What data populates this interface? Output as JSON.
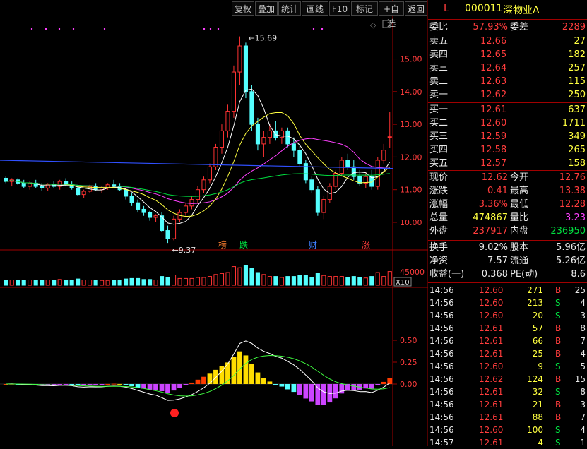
{
  "toolbar": {
    "buttons": [
      "复权",
      "叠加",
      "统计",
      "画线",
      "F10",
      "标记",
      "+自选",
      "返回"
    ]
  },
  "stock": {
    "flag": "L",
    "code": "000011",
    "name": "深物业A"
  },
  "order_ratio": {
    "label1": "委比",
    "value1": "57.93%",
    "label2": "委差",
    "value2": "2289"
  },
  "asks": [
    {
      "label": "卖五",
      "price": "12.66",
      "volume": "27"
    },
    {
      "label": "卖四",
      "price": "12.65",
      "volume": "182"
    },
    {
      "label": "卖三",
      "price": "12.64",
      "volume": "257"
    },
    {
      "label": "卖二",
      "price": "12.63",
      "volume": "115"
    },
    {
      "label": "卖一",
      "price": "12.62",
      "volume": "250"
    }
  ],
  "bids": [
    {
      "label": "买一",
      "price": "12.61",
      "volume": "637"
    },
    {
      "label": "买二",
      "price": "12.60",
      "volume": "1711"
    },
    {
      "label": "买三",
      "price": "12.59",
      "volume": "349"
    },
    {
      "label": "买四",
      "price": "12.58",
      "volume": "265"
    },
    {
      "label": "买五",
      "price": "12.57",
      "volume": "158"
    }
  ],
  "quote": [
    {
      "l1": "现价",
      "v1": "12.62",
      "c1": "red",
      "l2": "今开",
      "v2": "12.76",
      "c2": "red"
    },
    {
      "l1": "涨跌",
      "v1": "0.41",
      "c1": "red",
      "l2": "最高",
      "v2": "13.38",
      "c2": "red"
    },
    {
      "l1": "涨幅",
      "v1": "3.36%",
      "c1": "red",
      "l2": "最低",
      "v2": "12.28",
      "c2": "red"
    },
    {
      "l1": "总量",
      "v1": "474867",
      "c1": "yel",
      "l2": "量比",
      "v2": "3.23",
      "c2": "mag"
    },
    {
      "l1": "外盘",
      "v1": "237917",
      "c1": "red",
      "l2": "内盘",
      "v2": "236950",
      "c2": "green"
    }
  ],
  "fundamentals": [
    {
      "l1": "换手",
      "v1": "9.02%",
      "l2": "股本",
      "v2": "5.96亿"
    },
    {
      "l1": "净资",
      "v1": "7.57",
      "l2": "流通",
      "v2": "5.26亿"
    },
    {
      "l1": "收益(一)",
      "v1": "0.368",
      "l2": "PE(动)",
      "v2": "8.6"
    }
  ],
  "ticks": [
    {
      "time": "14:56",
      "price": "12.60",
      "vol": "271",
      "side": "B",
      "n": "25"
    },
    {
      "time": "14:56",
      "price": "12.60",
      "vol": "213",
      "side": "S",
      "n": "4"
    },
    {
      "time": "14:56",
      "price": "12.60",
      "vol": "20",
      "side": "S",
      "n": "3"
    },
    {
      "time": "14:56",
      "price": "12.61",
      "vol": "57",
      "side": "B",
      "n": "8"
    },
    {
      "time": "14:56",
      "price": "12.61",
      "vol": "66",
      "side": "B",
      "n": "7"
    },
    {
      "time": "14:56",
      "price": "12.61",
      "vol": "25",
      "side": "B",
      "n": "4"
    },
    {
      "time": "14:56",
      "price": "12.60",
      "vol": "9",
      "side": "S",
      "n": "5"
    },
    {
      "time": "14:56",
      "price": "12.62",
      "vol": "124",
      "side": "B",
      "n": "15"
    },
    {
      "time": "14:56",
      "price": "12.61",
      "vol": "32",
      "side": "S",
      "n": "8"
    },
    {
      "time": "14:56",
      "price": "12.61",
      "vol": "21",
      "side": "B",
      "n": "3"
    },
    {
      "time": "14:56",
      "price": "12.61",
      "vol": "88",
      "side": "B",
      "n": "7"
    },
    {
      "time": "14:56",
      "price": "12.60",
      "vol": "100",
      "side": "S",
      "n": "4"
    },
    {
      "time": "14:57",
      "price": "12.61",
      "vol": "4",
      "side": "S",
      "n": "1"
    }
  ],
  "chart_data": {
    "type": "candlestick",
    "price_axis": {
      "ticks": [
        "15.00",
        "14.00",
        "13.00",
        "12.00",
        "11.00",
        "10.00"
      ],
      "ylim": [
        9.2,
        16.2
      ]
    },
    "high_marker": "15.69",
    "low_marker": "9.37",
    "event_labels": [
      "榜",
      "跌",
      "财",
      "涨"
    ],
    "volume_axis": {
      "tick": "45000",
      "unit": "X10"
    },
    "macd_axis": {
      "ticks": [
        "0.50",
        "0.25",
        "0.00"
      ]
    },
    "candles": [
      [
        11.35,
        11.4,
        11.2,
        11.25
      ],
      [
        11.25,
        11.35,
        11.1,
        11.3
      ],
      [
        11.3,
        11.35,
        11.15,
        11.2
      ],
      [
        11.2,
        11.3,
        11.05,
        11.1
      ],
      [
        11.1,
        11.25,
        11.0,
        11.2
      ],
      [
        11.2,
        11.3,
        11.05,
        11.1
      ],
      [
        11.1,
        11.2,
        10.95,
        11.05
      ],
      [
        11.05,
        11.2,
        10.95,
        11.15
      ],
      [
        11.15,
        11.25,
        11.05,
        11.1
      ],
      [
        11.1,
        11.3,
        11.0,
        11.25
      ],
      [
        11.25,
        11.35,
        11.1,
        11.15
      ],
      [
        11.15,
        11.25,
        11.0,
        11.05
      ],
      [
        11.05,
        11.15,
        10.8,
        10.85
      ],
      [
        10.85,
        11.0,
        10.75,
        10.95
      ],
      [
        10.95,
        11.15,
        10.9,
        11.1
      ],
      [
        11.1,
        11.2,
        10.95,
        11.0
      ],
      [
        11.0,
        11.1,
        10.9,
        11.05
      ],
      [
        11.05,
        11.2,
        11.0,
        11.15
      ],
      [
        11.15,
        11.3,
        11.05,
        11.1
      ],
      [
        11.1,
        11.2,
        10.95,
        11.0
      ],
      [
        11.0,
        11.05,
        10.7,
        10.8
      ],
      [
        10.8,
        10.9,
        10.5,
        10.6
      ],
      [
        10.6,
        10.7,
        10.3,
        10.4
      ],
      [
        10.4,
        10.5,
        10.2,
        10.3
      ],
      [
        10.3,
        10.35,
        10.05,
        10.15
      ],
      [
        10.15,
        10.25,
        10.0,
        10.2
      ],
      [
        10.2,
        10.3,
        9.7,
        9.75
      ],
      [
        9.75,
        9.9,
        9.37,
        9.5
      ],
      [
        9.5,
        10.2,
        9.45,
        10.1
      ],
      [
        10.1,
        10.4,
        10.0,
        10.3
      ],
      [
        10.3,
        10.6,
        10.2,
        10.5
      ],
      [
        10.5,
        10.8,
        10.4,
        10.7
      ],
      [
        10.7,
        11.1,
        10.6,
        11.0
      ],
      [
        11.0,
        11.4,
        10.9,
        11.3
      ],
      [
        11.3,
        11.8,
        11.2,
        11.7
      ],
      [
        11.7,
        12.4,
        11.6,
        12.3
      ],
      [
        12.3,
        13.0,
        12.1,
        12.8
      ],
      [
        12.8,
        13.6,
        12.6,
        13.4
      ],
      [
        13.4,
        14.8,
        13.2,
        14.6
      ],
      [
        14.6,
        15.69,
        14.2,
        15.4
      ],
      [
        15.4,
        15.5,
        13.8,
        14.0
      ],
      [
        14.0,
        14.2,
        12.8,
        13.0
      ],
      [
        13.0,
        13.2,
        12.2,
        12.4
      ],
      [
        12.4,
        12.8,
        12.0,
        12.6
      ],
      [
        12.6,
        13.0,
        12.4,
        12.8
      ],
      [
        12.8,
        13.1,
        12.5,
        12.6
      ],
      [
        12.6,
        12.9,
        12.4,
        12.8
      ],
      [
        12.8,
        12.9,
        12.3,
        12.4
      ],
      [
        12.4,
        12.6,
        12.0,
        12.2
      ],
      [
        12.2,
        12.4,
        11.7,
        11.8
      ],
      [
        11.8,
        11.9,
        11.2,
        11.3
      ],
      [
        11.3,
        11.4,
        10.9,
        11.0
      ],
      [
        11.0,
        11.1,
        10.2,
        10.3
      ],
      [
        10.3,
        10.8,
        10.1,
        10.7
      ],
      [
        10.7,
        11.2,
        10.6,
        11.1
      ],
      [
        11.1,
        11.6,
        11.0,
        11.5
      ],
      [
        11.5,
        12.0,
        11.4,
        11.9
      ],
      [
        11.9,
        12.1,
        11.6,
        11.7
      ],
      [
        11.7,
        11.9,
        11.3,
        11.4
      ],
      [
        11.4,
        11.6,
        11.1,
        11.2
      ],
      [
        11.2,
        11.5,
        11.05,
        11.4
      ],
      [
        11.4,
        11.6,
        11.0,
        11.1
      ],
      [
        11.1,
        12.0,
        11.0,
        11.9
      ],
      [
        11.9,
        12.4,
        11.8,
        12.21
      ],
      [
        12.6,
        13.38,
        12.28,
        12.62
      ]
    ]
  }
}
